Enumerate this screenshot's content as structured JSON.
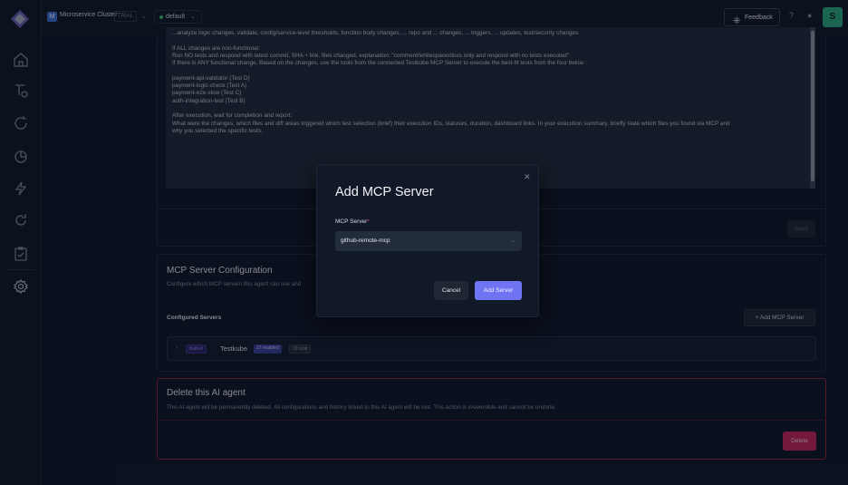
{
  "topbar": {
    "org_initial": "M",
    "org_name": "Microservice Cluster",
    "plan_badge": "TRIAL",
    "environment": "default",
    "feedback_label": "Feedback",
    "user_initial": "S"
  },
  "instructions": {
    "lines": [
      "...analyze logic changes, validate, config/service-level thresholds, function body changes, ... repo and ... changes, ... triggers, ... updates, test/security changes",
      "",
      "If ALL changes are non-functional:",
      "Run NO tests and respond with  latest commit, SHA + link,   files changed, explanation: \"comment/whitespace/docs only and respond with no tests executed\"",
      "If there is ANY functional change,  Based on the changes, use the tools from the connected Testkube MCP Server to execute the best-fit tests from the four below :",
      "",
      "payment-api-validator (Test D)",
      "payment-logic-check (Test A)",
      "payment-e2e-slow (Test C)",
      "auth-integration-test (Test B)",
      "",
      "After execution, wait for completion and report:",
      "What were the changes, which files and diff areas triggered which test selection (brief) their execution IDs, statuses, duration, dashboard links. In your execution summary, briefly state which files you found via MCP and",
      "why you selected the specific tests."
    ],
    "save_label": "Save"
  },
  "mcp_config": {
    "title": "MCP Server Configuration",
    "subtitle": "Configure which MCP servers this agent can use and",
    "configured_label": "Configured Servers",
    "add_button": "+ Add MCP Server",
    "server": {
      "builtin_badge": "Built-in",
      "name": "Testkube",
      "enabled_badge": "27 enabled",
      "total_badge": "30 total"
    }
  },
  "danger_zone": {
    "title": "Delete this AI agent",
    "description": "This AI agent will be permanently deleted. All configurations and history linked to this AI agent will be lost. This action is irreversible and cannot be undone.",
    "delete_label": "Delete"
  },
  "modal": {
    "title": "Add MCP Server",
    "field_label": "MCP Server",
    "required_mark": "*",
    "selected_value": "github-remote-mcp",
    "cancel_label": "Cancel",
    "submit_label": "Add Server"
  },
  "colors": {
    "accent": "#6e74f2",
    "danger": "#c4245c",
    "success": "#28a57f"
  },
  "icons": [
    "logo-icon",
    "home-icon",
    "tests-icon",
    "refresh-icon",
    "chart-icon",
    "lightning-icon",
    "sync-icon",
    "clipboard-icon",
    "settings-icon",
    "feedback-icon",
    "help-icon",
    "bell-icon",
    "close-icon",
    "chevron-down-icon",
    "chevron-right-icon"
  ]
}
